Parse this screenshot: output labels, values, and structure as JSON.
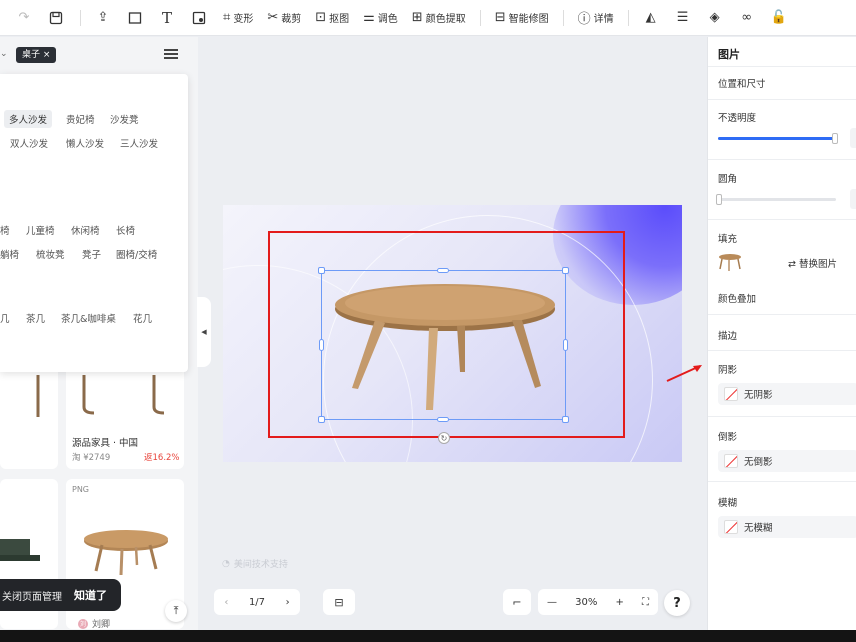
{
  "toolbar": {
    "items": [
      {
        "label": "变形",
        "icon": "transform-icon"
      },
      {
        "label": "裁剪",
        "icon": "scissors-icon"
      },
      {
        "label": "抠图",
        "icon": "matting-icon"
      },
      {
        "label": "调色",
        "icon": "adjust-icon"
      },
      {
        "label": "颜色提取",
        "icon": "color-picker-icon"
      },
      {
        "label": "智能修图",
        "icon": "smart-retouch-icon"
      },
      {
        "label": "详情",
        "icon": "info-icon"
      }
    ]
  },
  "left": {
    "search_tag": "桌子 ×",
    "categories": [
      {
        "label": "多人沙发",
        "active": true
      },
      {
        "label": "贵妃椅"
      },
      {
        "label": "沙发凳"
      },
      {
        "label": "双人沙发"
      },
      {
        "label": "懒人沙发"
      },
      {
        "label": "三人沙发"
      },
      {
        "label": "椅"
      },
      {
        "label": "儿童椅"
      },
      {
        "label": "休闲椅"
      },
      {
        "label": "长椅"
      },
      {
        "label": "躺椅"
      },
      {
        "label": "梳妆凳"
      },
      {
        "label": "凳子"
      },
      {
        "label": "圈椅/交椅"
      },
      {
        "label": "几"
      },
      {
        "label": "茶几"
      },
      {
        "label": "茶几&咖啡桌"
      },
      {
        "label": "花几"
      }
    ],
    "card1": {
      "title": "源品家具 · 中国",
      "price": "淘 ¥2749",
      "discount": "返16.2%"
    },
    "card2": {
      "badge": "PNG"
    },
    "toast": {
      "message": "关闭页面管理",
      "confirm": "知道了"
    },
    "author": {
      "name": "刘卿",
      "avatar": "刘"
    }
  },
  "canvas": {
    "watermark": "美间技术支持"
  },
  "bottom": {
    "page": "1/7",
    "zoom": "30%",
    "help": "?"
  },
  "right": {
    "title": "图片",
    "position_size": "位置和尺寸",
    "opacity": {
      "label": "不透明度",
      "value": 1.0
    },
    "radius": {
      "label": "圆角",
      "value": 0
    },
    "fill": {
      "label": "填充",
      "replace": "替换图片"
    },
    "color_overlay": "颜色叠加",
    "stroke": "描边",
    "shadow": {
      "label": "阴影",
      "value": "无阴影"
    },
    "reflection": {
      "label": "倒影",
      "value": "无倒影"
    },
    "blur": {
      "label": "模糊",
      "value": "无模糊"
    }
  },
  "colors": {
    "accent": "#2f6cf5",
    "highlight": "#e31b1b",
    "selection": "#6d9bf7"
  }
}
